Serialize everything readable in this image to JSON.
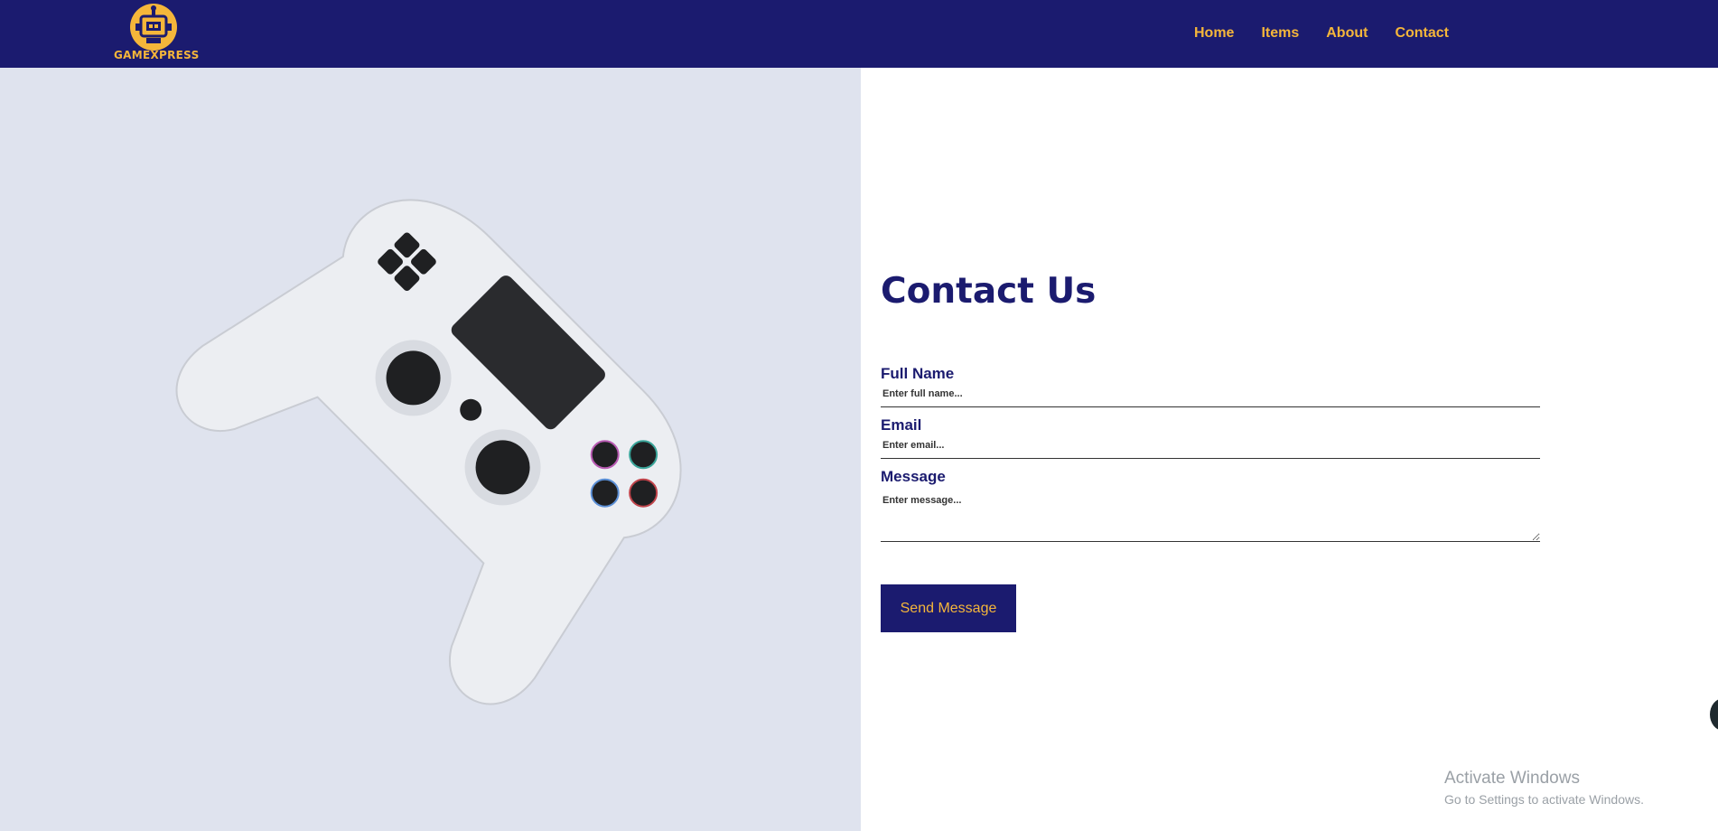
{
  "brand": {
    "logo_text": "GAMEXPRESS"
  },
  "nav": {
    "items": [
      "Home",
      "Items",
      "About",
      "Contact"
    ]
  },
  "contact": {
    "title": "Contact Us",
    "fields": {
      "full_name": {
        "label": "Full Name",
        "placeholder": "Enter full name..."
      },
      "email": {
        "label": "Email",
        "placeholder": "Enter email..."
      },
      "message": {
        "label": "Message",
        "placeholder": "Enter message..."
      }
    },
    "submit_label": "Send Message"
  },
  "os_watermark": {
    "title": "Activate Windows",
    "subtitle": "Go to Settings to activate Windows."
  },
  "colors": {
    "header_bg": "#1b1b6f",
    "accent": "#f5b63a",
    "left_panel_bg": "#dfe3ee",
    "title_color": "#1b1b6f"
  }
}
